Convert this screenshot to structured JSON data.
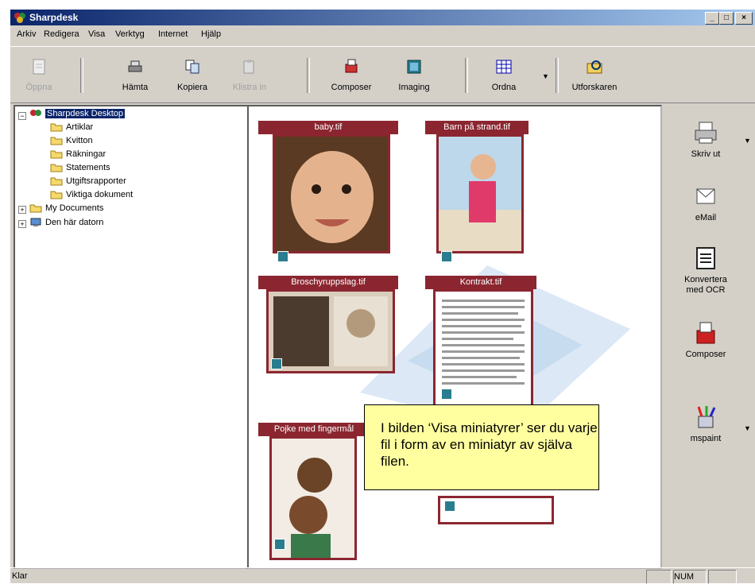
{
  "window": {
    "title": "Sharpdesk"
  },
  "menu": [
    "Arkiv",
    "Redigera",
    "Visa",
    "Verktyg",
    "Internet",
    "Hjälp"
  ],
  "toolbar": {
    "buttons": [
      {
        "label": "Öppna",
        "icon": "open-icon",
        "enabled": false
      },
      {
        "label": "Hämta",
        "icon": "scanner-icon",
        "enabled": true
      },
      {
        "label": "Kopiera",
        "icon": "copy-icon",
        "enabled": true
      },
      {
        "label": "Klistra in",
        "icon": "paste-icon",
        "enabled": false
      },
      {
        "label": "Composer",
        "icon": "composer-icon",
        "enabled": true
      },
      {
        "label": "Imaging",
        "icon": "imaging-icon",
        "enabled": true
      },
      {
        "label": "Ordna",
        "icon": "arrange-icon",
        "enabled": true
      },
      {
        "label": "Utforskaren",
        "icon": "explorer-icon",
        "enabled": true
      }
    ]
  },
  "tree": {
    "root": "Sharpdesk Desktop",
    "children": [
      "Artiklar",
      "Kvitton",
      "Räkningar",
      "Statements",
      "Utgiftsrapporter",
      "Viktiga dokument"
    ],
    "others": [
      "My Documents",
      "Den här datorn"
    ]
  },
  "thumbnails": [
    {
      "caption": "baby.tif"
    },
    {
      "caption": "Barn på strand.tif"
    },
    {
      "caption": "Broschyruppslag.tif"
    },
    {
      "caption": "Kontrakt.tif"
    },
    {
      "caption": "Pojke med fingermål"
    }
  ],
  "callout": {
    "text": "I bilden ‘Visa miniatyrer’ ser du varje fil i form av en miniatyr av själva filen."
  },
  "actions": [
    {
      "label": "Skriv ut",
      "icon": "printer-icon"
    },
    {
      "label": "eMail",
      "icon": "email-icon"
    },
    {
      "label": "Konvertera med OCR",
      "icon": "ocr-icon"
    },
    {
      "label": "Composer",
      "icon": "composer-app-icon"
    },
    {
      "label": "mspaint",
      "icon": "paint-icon"
    }
  ],
  "status": {
    "text": "Klar",
    "num": "NUM"
  },
  "colors": {
    "caption": "#8b2630",
    "selection": "#0a246a",
    "callout": "#ffffa0"
  }
}
